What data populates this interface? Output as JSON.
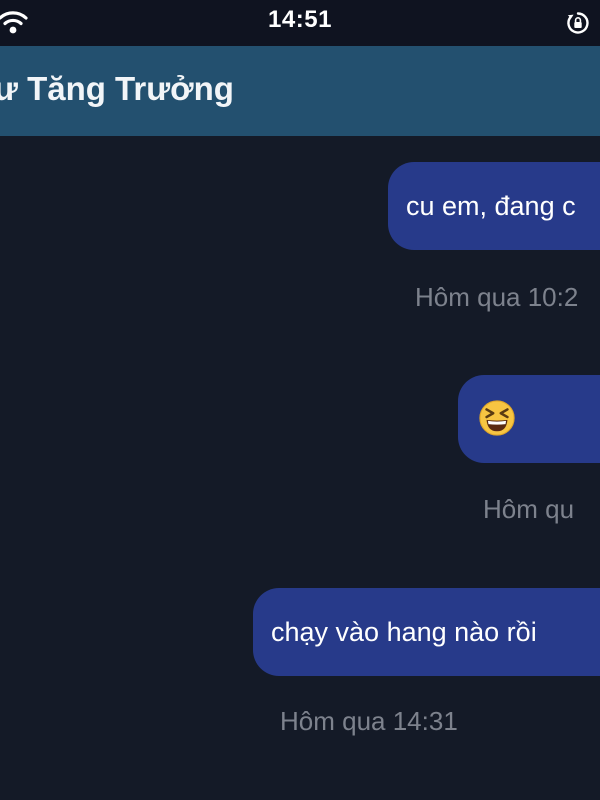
{
  "status_bar": {
    "time": "14:51"
  },
  "header": {
    "title": "ư Tăng Trưởng"
  },
  "messages": [
    {
      "text": "cu em, đang c",
      "timestamp": "Hôm qua 10:2"
    },
    {
      "emoji": "grinning-squinting-face",
      "timestamp": "Hôm qu"
    },
    {
      "text": "chạy vào hang nào rồi",
      "timestamp": "Hôm qua 14:31"
    }
  ],
  "colors": {
    "background": "#141a27",
    "status_bar": "#0f1320",
    "header": "#23506f",
    "bubble": "#273a8a",
    "timestamp": "#7d828d"
  }
}
